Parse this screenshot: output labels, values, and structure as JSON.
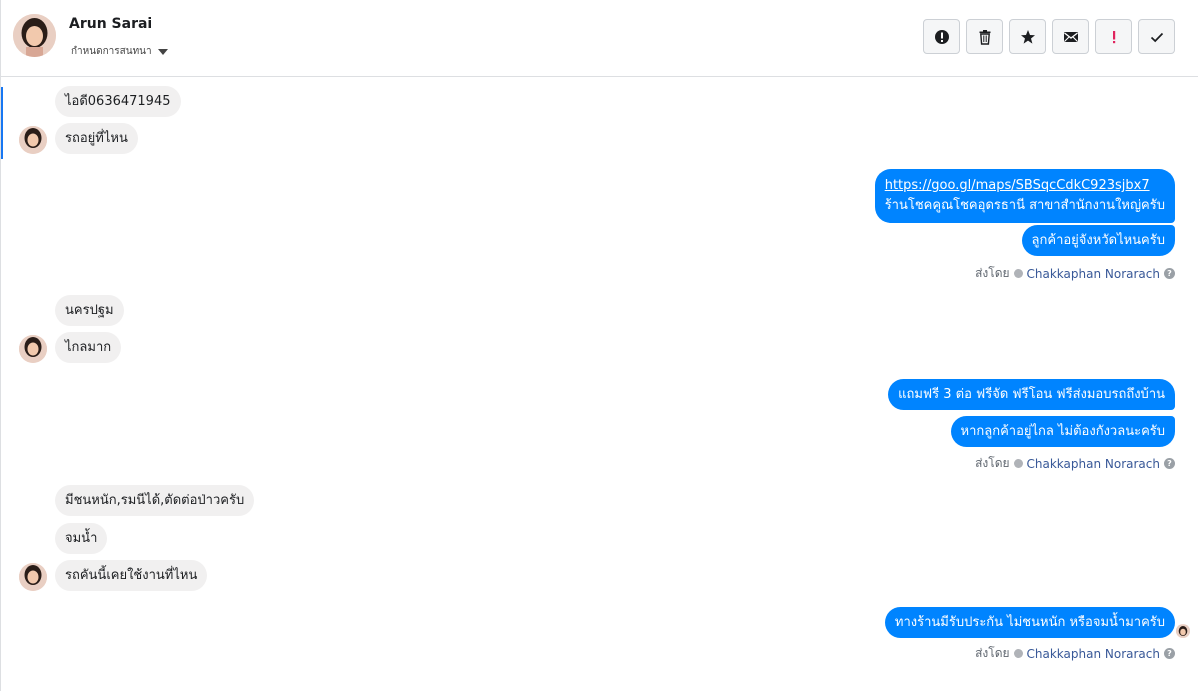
{
  "contact": {
    "name": "Arun Sarai",
    "subtitle": "กำหนดการสนทนา"
  },
  "toolbar": {
    "buttons": [
      {
        "icon": "alert-circle-icon"
      },
      {
        "icon": "trash-icon"
      },
      {
        "icon": "star-icon"
      },
      {
        "icon": "envelope-icon"
      },
      {
        "icon": "exclamation-icon"
      },
      {
        "icon": "checkmark-icon"
      }
    ],
    "accent_red": "#e0245e"
  },
  "messages": {
    "m1": "ไอดี0636471945",
    "m2": "รถอยู่ที่ไหน",
    "m3_link": "https://goo.gl/maps/SBSqcCdkC923sjbx7",
    "m3_text": "ร้านโชคคูณโชคอุดรธานี สาขาสำนักงานใหญ่ครับ",
    "m4": "ลูกค้าอยู่จังหวัดไหนครับ",
    "m5": "นครปฐม",
    "m6": "ไกลมาก",
    "m7": "แถมฟรี 3 ต่อ ฟรีจัด ฟรีโอน  ฟรีส่งมอบรถถึงบ้าน",
    "m8": "หากลูกค้าอยู่ไกล ไม่ต้องกังวลนะครับ",
    "m9": "มีชนหนัก,รมนีได้,ตัดต่อป่าวครับ",
    "m10": "จมน้ำ",
    "m11": "รถคันนี้เคยใช้งานที่ไหน",
    "m12": "ทางร้านมีรับประกัน ไม่ชนหนัก หรือจมน้ำมาครับ"
  },
  "sent_by": {
    "label": "ส่งโดย",
    "author": "Chakkaphan Norarach"
  },
  "colors": {
    "outgoing": "#0084ff",
    "incoming": "#f1f0f0",
    "accent": "#1877f2"
  }
}
